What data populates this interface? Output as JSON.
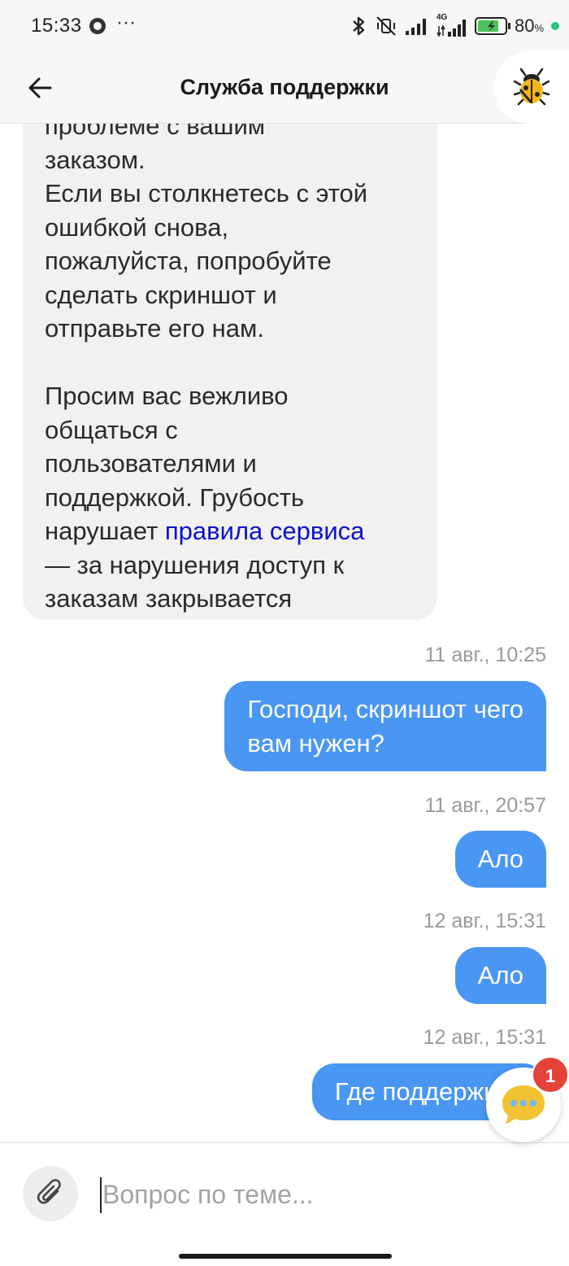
{
  "status_bar": {
    "time": "15:33",
    "dots": "···",
    "battery_percent": "80",
    "battery_percent_sign": "%",
    "battery_level": 0.8,
    "network_label": "4G"
  },
  "header": {
    "title": "Служба поддержки",
    "back_icon": "arrow-left-icon",
    "bug_icon": "bug-icon"
  },
  "messages": {
    "support": {
      "text_before_link": "проблеме с вашим\nзаказом.\nЕсли вы столкнетесь с этой\nошибкой снова,\nпожалуйста, попробуйте\nсделать скриншот и\nотправьте его нам.\n\nПросим вас вежливо\nобщаться с\nпользователями и\nподдержкой. Грубость\nнарушает ",
      "link_text": "правила сервиса",
      "text_after_link": "\n— за нарушения доступ к\nзаказам закрывается"
    },
    "outgoing": [
      {
        "time": "11 авг., 10:25",
        "text": "Господи, скриншот чего\nвам нужен?"
      },
      {
        "time": "11 авг., 20:57",
        "text": "Ало"
      },
      {
        "time": "12 авг., 15:31",
        "text": "Ало"
      },
      {
        "time": "12 авг., 15:31",
        "text": "Где поддержка?"
      }
    ]
  },
  "chat_button": {
    "badge": "1",
    "icon": "chat-bubble-icon"
  },
  "input": {
    "placeholder": "Вопрос по теме...",
    "value": "",
    "attach_icon": "paperclip-icon"
  },
  "colors": {
    "outgoing_bubble": "#4a96f3",
    "support_bubble": "#f2f1ef",
    "link": "#0b14c6",
    "badge": "#e5423a"
  }
}
